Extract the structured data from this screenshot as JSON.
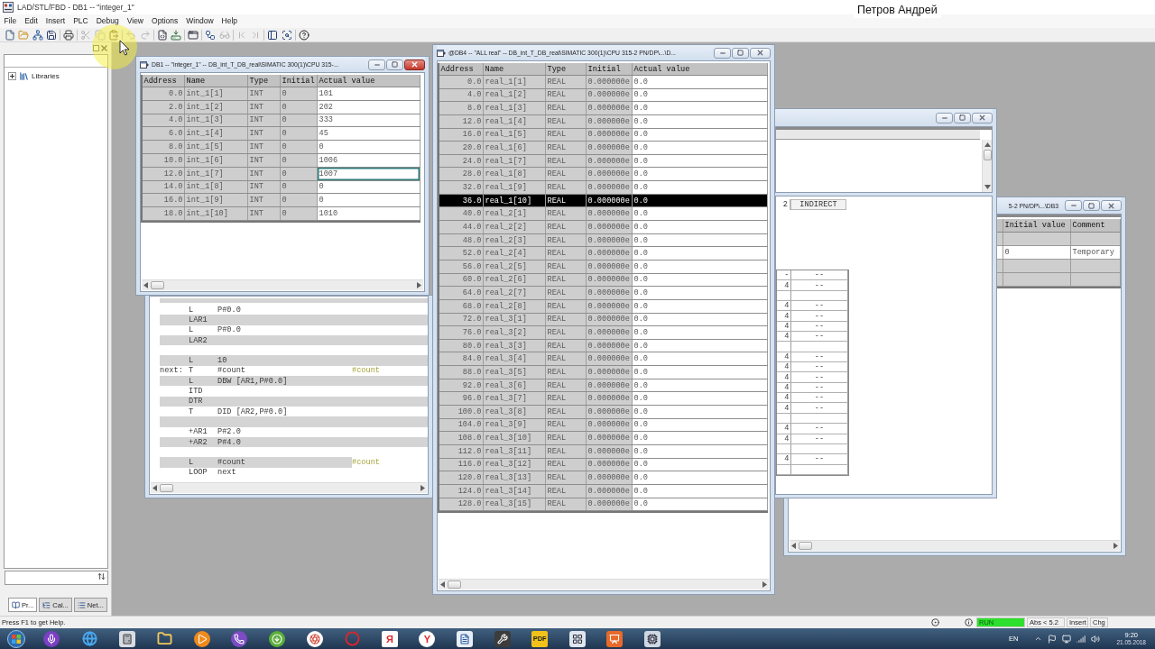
{
  "app_window": {
    "title": "LAD/STL/FBD - DB1 -- \"integer_1\""
  },
  "presenter_name": "Петров Андрей",
  "menu": [
    "File",
    "Edit",
    "Insert",
    "PLC",
    "Debug",
    "View",
    "Options",
    "Window",
    "Help"
  ],
  "toolbar": {
    "groups": [
      [
        {
          "kind": "new",
          "disabled": false
        },
        {
          "kind": "open",
          "disabled": false
        },
        {
          "kind": "nodes",
          "disabled": false
        },
        {
          "kind": "save",
          "disabled": false
        }
      ],
      [
        {
          "kind": "print",
          "disabled": false
        }
      ],
      [
        {
          "kind": "cut",
          "disabled": true
        },
        {
          "kind": "copy",
          "disabled": true
        },
        {
          "kind": "paste",
          "disabled": false
        }
      ],
      [
        {
          "kind": "undo",
          "disabled": true
        },
        {
          "kind": "redo",
          "disabled": true
        }
      ],
      [
        {
          "kind": "compile",
          "disabled": false
        },
        {
          "kind": "download",
          "disabled": false
        }
      ],
      [
        {
          "kind": "overview",
          "disabled": false
        }
      ],
      [
        {
          "kind": "connect",
          "disabled": false
        },
        {
          "kind": "monitor",
          "disabled": true
        }
      ],
      [
        {
          "kind": "prev_error",
          "disabled": true
        },
        {
          "kind": "next_error",
          "disabled": true
        }
      ],
      [
        {
          "kind": "layout",
          "disabled": false
        },
        {
          "kind": "details",
          "disabled": false
        }
      ],
      [
        {
          "kind": "help",
          "disabled": false
        }
      ]
    ]
  },
  "catalog": {
    "tree": [
      {
        "label": "Libraries",
        "expanded": false
      }
    ],
    "tabs": [
      {
        "kind": "program",
        "label": "Pr...",
        "selected": true
      },
      {
        "kind": "calls",
        "label": "Cal...",
        "selected": false
      },
      {
        "kind": "networks",
        "label": "Net...",
        "selected": false
      }
    ]
  },
  "db1_window": {
    "title": "DB1 -- \"integer_1\" -- DB_int_T_DB_real\\SIMATIC 300(1)\\CPU 315-...",
    "active": true,
    "table": {
      "columns": [
        "Address",
        "Name",
        "Type",
        "Initial",
        "Actual value"
      ],
      "rows": [
        {
          "address": "0.0",
          "name": "int_1[1]",
          "type": "INT",
          "initial": "0",
          "actual": "101",
          "selected": false,
          "editing": false
        },
        {
          "address": "2.0",
          "name": "int_1[2]",
          "type": "INT",
          "initial": "0",
          "actual": "202",
          "selected": false,
          "editing": false
        },
        {
          "address": "4.0",
          "name": "int_1[3]",
          "type": "INT",
          "initial": "0",
          "actual": "333",
          "selected": false,
          "editing": false
        },
        {
          "address": "6.0",
          "name": "int_1[4]",
          "type": "INT",
          "initial": "0",
          "actual": "45",
          "selected": false,
          "editing": false
        },
        {
          "address": "8.0",
          "name": "int_1[5]",
          "type": "INT",
          "initial": "0",
          "actual": "0",
          "selected": false,
          "editing": false
        },
        {
          "address": "10.0",
          "name": "int_1[6]",
          "type": "INT",
          "initial": "0",
          "actual": "1006",
          "selected": false,
          "editing": false
        },
        {
          "address": "12.0",
          "name": "int_1[7]",
          "type": "INT",
          "initial": "0",
          "actual": "1007",
          "selected": false,
          "editing": true
        },
        {
          "address": "14.0",
          "name": "int_1[8]",
          "type": "INT",
          "initial": "0",
          "actual": "0",
          "selected": false,
          "editing": false
        },
        {
          "address": "16.0",
          "name": "int_1[9]",
          "type": "INT",
          "initial": "0",
          "actual": "0",
          "selected": false,
          "editing": false
        },
        {
          "address": "18.0",
          "name": "int_1[10]",
          "type": "INT",
          "initial": "0",
          "actual": "1010",
          "selected": false,
          "editing": false
        }
      ]
    }
  },
  "stl_window": {
    "lines": [
      {
        "kind": "statement",
        "op": "L",
        "operand": "P#0.0"
      },
      {
        "kind": "statement",
        "op": "LAR1"
      },
      {
        "kind": "statement",
        "op": "L",
        "operand": "P#0.0"
      },
      {
        "kind": "statement",
        "op": "LAR2"
      },
      {
        "kind": "blank"
      },
      {
        "kind": "statement",
        "op": "L",
        "operand": "10"
      },
      {
        "kind": "statement",
        "label": "next:",
        "op": "T",
        "operand": "#count",
        "comment": "#count"
      },
      {
        "kind": "statement",
        "op": "L",
        "operand": "DBW [AR1,P#0.0]"
      },
      {
        "kind": "statement",
        "op": "ITD"
      },
      {
        "kind": "statement",
        "op": "DTR"
      },
      {
        "kind": "statement",
        "op": "T",
        "operand": "DID [AR2,P#0.0]"
      },
      {
        "kind": "blank"
      },
      {
        "kind": "statement",
        "op": "+AR1",
        "operand": "P#2.0"
      },
      {
        "kind": "statement",
        "op": "+AR2",
        "operand": "P#4.0"
      },
      {
        "kind": "blank"
      },
      {
        "kind": "statement",
        "op": "L",
        "operand": "#count",
        "comment": "#count"
      },
      {
        "kind": "statement",
        "op": "LOOP",
        "operand": "next"
      }
    ]
  },
  "db4_window": {
    "title": "@DB4 -- \"ALL real\" -- DB_int_T_DB_real\\SIMATIC 300(1)\\CPU 315-2 PN/DP\\...\\D...",
    "active": false,
    "table": {
      "columns": [
        "Address",
        "Name",
        "Type",
        "Initial",
        "Actual value"
      ],
      "rows": [
        {
          "address": "0.0",
          "name": "real_1[1]",
          "type": "REAL",
          "initial": "0.000000e",
          "actual": "0.0",
          "selected": false
        },
        {
          "address": "4.0",
          "name": "real_1[2]",
          "type": "REAL",
          "initial": "0.000000e",
          "actual": "0.0",
          "selected": false
        },
        {
          "address": "8.0",
          "name": "real_1[3]",
          "type": "REAL",
          "initial": "0.000000e",
          "actual": "0.0",
          "selected": false
        },
        {
          "address": "12.0",
          "name": "real_1[4]",
          "type": "REAL",
          "initial": "0.000000e",
          "actual": "0.0",
          "selected": false
        },
        {
          "address": "16.0",
          "name": "real_1[5]",
          "type": "REAL",
          "initial": "0.000000e",
          "actual": "0.0",
          "selected": false
        },
        {
          "address": "20.0",
          "name": "real_1[6]",
          "type": "REAL",
          "initial": "0.000000e",
          "actual": "0.0",
          "selected": false
        },
        {
          "address": "24.0",
          "name": "real_1[7]",
          "type": "REAL",
          "initial": "0.000000e",
          "actual": "0.0",
          "selected": false
        },
        {
          "address": "28.0",
          "name": "real_1[8]",
          "type": "REAL",
          "initial": "0.000000e",
          "actual": "0.0",
          "selected": false
        },
        {
          "address": "32.0",
          "name": "real_1[9]",
          "type": "REAL",
          "initial": "0.000000e",
          "actual": "0.0",
          "selected": false
        },
        {
          "address": "36.0",
          "name": "real_1[10]",
          "type": "REAL",
          "initial": "0.000000e",
          "actual": "0.0",
          "selected": true
        },
        {
          "address": "40.0",
          "name": "real_2[1]",
          "type": "REAL",
          "initial": "0.000000e",
          "actual": "0.0",
          "selected": false
        },
        {
          "address": "44.0",
          "name": "real_2[2]",
          "type": "REAL",
          "initial": "0.000000e",
          "actual": "0.0",
          "selected": false
        },
        {
          "address": "48.0",
          "name": "real_2[3]",
          "type": "REAL",
          "initial": "0.000000e",
          "actual": "0.0",
          "selected": false
        },
        {
          "address": "52.0",
          "name": "real_2[4]",
          "type": "REAL",
          "initial": "0.000000e",
          "actual": "0.0",
          "selected": false
        },
        {
          "address": "56.0",
          "name": "real_2[5]",
          "type": "REAL",
          "initial": "0.000000e",
          "actual": "0.0",
          "selected": false
        },
        {
          "address": "60.0",
          "name": "real_2[6]",
          "type": "REAL",
          "initial": "0.000000e",
          "actual": "0.0",
          "selected": false
        },
        {
          "address": "64.0",
          "name": "real_2[7]",
          "type": "REAL",
          "initial": "0.000000e",
          "actual": "0.0",
          "selected": false
        },
        {
          "address": "68.0",
          "name": "real_2[8]",
          "type": "REAL",
          "initial": "0.000000e",
          "actual": "0.0",
          "selected": false
        },
        {
          "address": "72.0",
          "name": "real_3[1]",
          "type": "REAL",
          "initial": "0.000000e",
          "actual": "0.0",
          "selected": false
        },
        {
          "address": "76.0",
          "name": "real_3[2]",
          "type": "REAL",
          "initial": "0.000000e",
          "actual": "0.0",
          "selected": false
        },
        {
          "address": "80.0",
          "name": "real_3[3]",
          "type": "REAL",
          "initial": "0.000000e",
          "actual": "0.0",
          "selected": false
        },
        {
          "address": "84.0",
          "name": "real_3[4]",
          "type": "REAL",
          "initial": "0.000000e",
          "actual": "0.0",
          "selected": false
        },
        {
          "address": "88.0",
          "name": "real_3[5]",
          "type": "REAL",
          "initial": "0.000000e",
          "actual": "0.0",
          "selected": false
        },
        {
          "address": "92.0",
          "name": "real_3[6]",
          "type": "REAL",
          "initial": "0.000000e",
          "actual": "0.0",
          "selected": false
        },
        {
          "address": "96.0",
          "name": "real_3[7]",
          "type": "REAL",
          "initial": "0.000000e",
          "actual": "0.0",
          "selected": false
        },
        {
          "address": "100.0",
          "name": "real_3[8]",
          "type": "REAL",
          "initial": "0.000000e",
          "actual": "0.0",
          "selected": false
        },
        {
          "address": "104.0",
          "name": "real_3[9]",
          "type": "REAL",
          "initial": "0.000000e",
          "actual": "0.0",
          "selected": false
        },
        {
          "address": "108.0",
          "name": "real_3[10]",
          "type": "REAL",
          "initial": "0.000000e",
          "actual": "0.0",
          "selected": false
        },
        {
          "address": "112.0",
          "name": "real_3[11]",
          "type": "REAL",
          "initial": "0.000000e",
          "actual": "0.0",
          "selected": false
        },
        {
          "address": "116.0",
          "name": "real_3[12]",
          "type": "REAL",
          "initial": "0.000000e",
          "actual": "0.0",
          "selected": false
        },
        {
          "address": "120.0",
          "name": "real_3[13]",
          "type": "REAL",
          "initial": "0.000000e",
          "actual": "0.0",
          "selected": false
        },
        {
          "address": "124.0",
          "name": "real_3[14]",
          "type": "REAL",
          "initial": "0.000000e",
          "actual": "0.0",
          "selected": false
        },
        {
          "address": "128.0",
          "name": "real_3[15]",
          "type": "REAL",
          "initial": "0.000000e",
          "actual": "0.0",
          "selected": false
        }
      ]
    }
  },
  "xref_window": {
    "active": false,
    "header": [
      "2",
      "INDIRECT"
    ],
    "rows": [
      {
        "kind": "entry",
        "column_1": "-",
        "column_2": "--"
      },
      {
        "kind": "entry",
        "column_1": "4",
        "column_2": "--"
      },
      {
        "kind": "blank"
      },
      {
        "kind": "entry",
        "column_1": "4",
        "column_2": "--"
      },
      {
        "kind": "entry",
        "column_1": "4",
        "column_2": "--"
      },
      {
        "kind": "entry",
        "column_1": "4",
        "column_2": "--"
      },
      {
        "kind": "entry",
        "column_1": "4",
        "column_2": "--"
      },
      {
        "kind": "blank"
      },
      {
        "kind": "entry",
        "column_1": "4",
        "column_2": "--"
      },
      {
        "kind": "entry",
        "column_1": "4",
        "column_2": "--"
      },
      {
        "kind": "entry",
        "column_1": "4",
        "column_2": "--"
      },
      {
        "kind": "entry",
        "column_1": "4",
        "column_2": "--"
      },
      {
        "kind": "entry",
        "column_1": "4",
        "column_2": "--"
      },
      {
        "kind": "entry",
        "column_1": "4",
        "column_2": "--"
      },
      {
        "kind": "blank"
      },
      {
        "kind": "entry",
        "column_1": "4",
        "column_2": "--"
      },
      {
        "kind": "entry",
        "column_1": "4",
        "column_2": "--"
      },
      {
        "kind": "blank"
      },
      {
        "kind": "entry",
        "column_1": "4",
        "column_2": "--"
      },
      {
        "kind": "blank"
      }
    ]
  },
  "db3_window": {
    "title": "5-2 PN/DP\\...\\DB3",
    "active": false,
    "table": {
      "columns": [
        "Initial value",
        "Comment"
      ],
      "rows": [
        {
          "kind": "blank"
        },
        {
          "kind": "entry",
          "initial_value": "0",
          "comment": "Temporary"
        },
        {
          "kind": "blank"
        },
        {
          "kind": "blank"
        }
      ]
    }
  },
  "status_bar": {
    "hint": "Press F1 to get Help.",
    "mode": "RUN",
    "address": "Abs < 5.2",
    "insert_mode": "Insert",
    "change": "Chg"
  },
  "taskbar": {
    "apps": [
      {
        "kind": "microphone"
      },
      {
        "kind": "browser"
      },
      {
        "kind": "calculator"
      },
      {
        "kind": "folder"
      },
      {
        "kind": "player"
      },
      {
        "kind": "phone"
      },
      {
        "kind": "torrent"
      },
      {
        "kind": "aperture"
      },
      {
        "kind": "ring"
      },
      {
        "kind": "letter_doc",
        "glyph": "Я"
      },
      {
        "kind": "letter_round",
        "glyph": "Y"
      },
      {
        "kind": "document"
      },
      {
        "kind": "tool"
      },
      {
        "kind": "letter_tile",
        "glyph": "PDF"
      },
      {
        "kind": "window"
      },
      {
        "kind": "slides"
      },
      {
        "kind": "chip"
      }
    ],
    "language": "EN",
    "time": "9:20",
    "date": "21.05.2018"
  }
}
